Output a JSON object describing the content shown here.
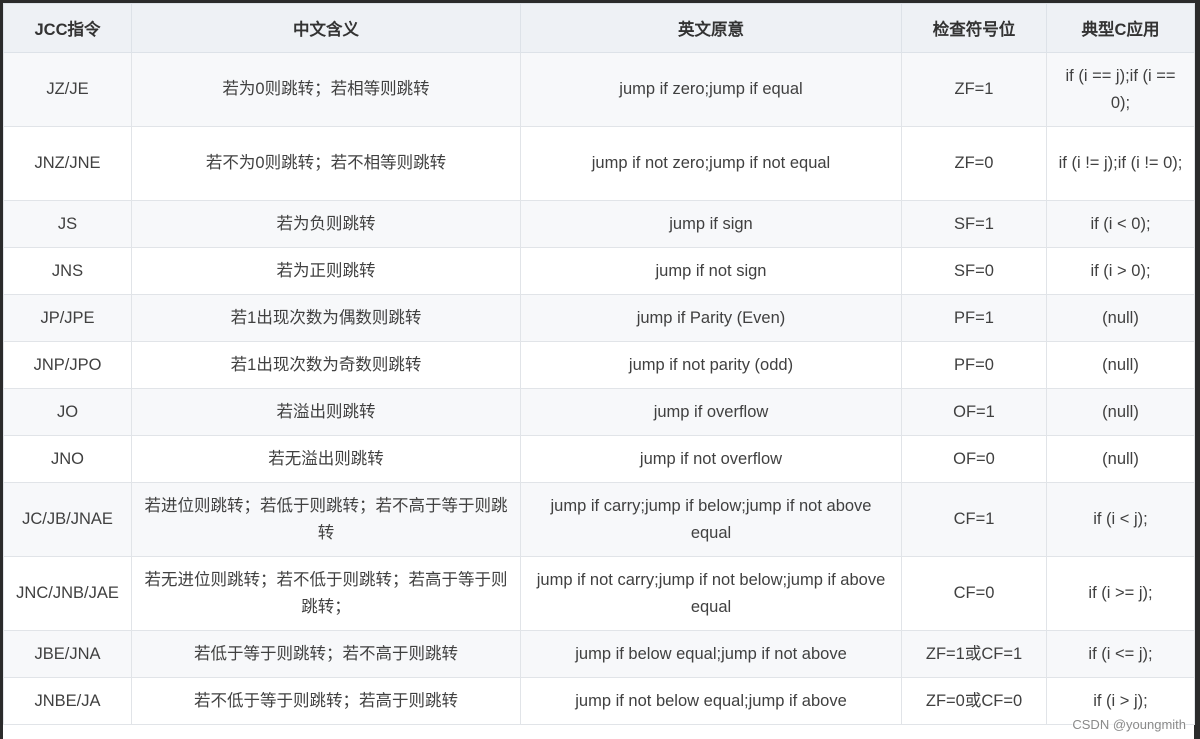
{
  "headers": [
    "JCC指令",
    "中文含义",
    "英文原意",
    "检查符号位",
    "典型C应用"
  ],
  "rows": [
    [
      "JZ/JE",
      "若为0则跳转；若相等则跳转",
      "jump if zero;jump if equal",
      "ZF=1",
      "if (i == j);if (i == 0);"
    ],
    [
      "JNZ/JNE",
      "若不为0则跳转；若不相等则跳转",
      "jump if not zero;jump if not equal",
      "ZF=0",
      "if (i != j);if (i != 0);"
    ],
    [
      "JS",
      "若为负则跳转",
      "jump if sign",
      "SF=1",
      "if (i < 0);"
    ],
    [
      "JNS",
      "若为正则跳转",
      "jump if not sign",
      "SF=0",
      "if (i > 0);"
    ],
    [
      "JP/JPE",
      "若1出现次数为偶数则跳转",
      "jump if Parity (Even)",
      "PF=1",
      "(null)"
    ],
    [
      "JNP/JPO",
      "若1出现次数为奇数则跳转",
      "jump if not parity (odd)",
      "PF=0",
      "(null)"
    ],
    [
      "JO",
      "若溢出则跳转",
      "jump if overflow",
      "OF=1",
      "(null)"
    ],
    [
      "JNO",
      "若无溢出则跳转",
      "jump if not overflow",
      "OF=0",
      "(null)"
    ],
    [
      "JC/JB/JNAE",
      "若进位则跳转；若低于则跳转；若不高于等于则跳转",
      "jump if carry;jump if below;jump if not above equal",
      "CF=1",
      "if (i < j);"
    ],
    [
      "JNC/JNB/JAE",
      "若无进位则跳转；若不低于则跳转；若高于等于则跳转；",
      "jump if not carry;jump if not below;jump if above equal",
      "CF=0",
      "if (i >= j);"
    ],
    [
      "JBE/JNA",
      "若低于等于则跳转；若不高于则跳转",
      "jump if below equal;jump if not above",
      "ZF=1或CF=1",
      "if (i <= j);"
    ],
    [
      "JNBE/JA",
      "若不低于等于则跳转；若高于则跳转",
      "jump if not below equal;jump if above",
      "ZF=0或CF=0",
      "if (i > j);"
    ]
  ],
  "watermark": "CSDN @youngmith"
}
